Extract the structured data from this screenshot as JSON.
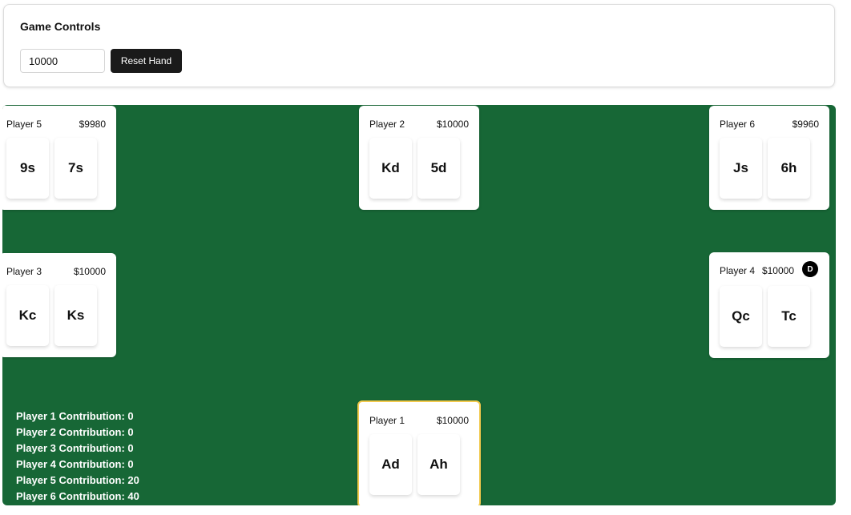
{
  "controls": {
    "title": "Game Controls",
    "amount_value": "10000",
    "reset_label": "Reset Hand"
  },
  "table": {
    "felt_color": "#176736",
    "active_border_color": "#f2c94c",
    "dealer_marker": "D",
    "dealer_seat": "Player 4",
    "active_seat": "Player 1",
    "seats": [
      {
        "name": "Player 5",
        "stack": "$9980",
        "cards": [
          "9s",
          "7s"
        ]
      },
      {
        "name": "Player 2",
        "stack": "$10000",
        "cards": [
          "Kd",
          "5d"
        ]
      },
      {
        "name": "Player 6",
        "stack": "$9960",
        "cards": [
          "Js",
          "6h"
        ]
      },
      {
        "name": "Player 3",
        "stack": "$10000",
        "cards": [
          "Kc",
          "Ks"
        ]
      },
      {
        "name": "Player 4",
        "stack": "$10000",
        "cards": [
          "Qc",
          "Tc"
        ]
      },
      {
        "name": "Player 1",
        "stack": "$10000",
        "cards": [
          "Ad",
          "Ah"
        ]
      }
    ],
    "contributions": [
      "Player 1 Contribution: 0",
      "Player 2 Contribution: 0",
      "Player 3 Contribution: 0",
      "Player 4 Contribution: 0",
      "Player 5 Contribution: 20",
      "Player 6 Contribution: 40"
    ]
  }
}
